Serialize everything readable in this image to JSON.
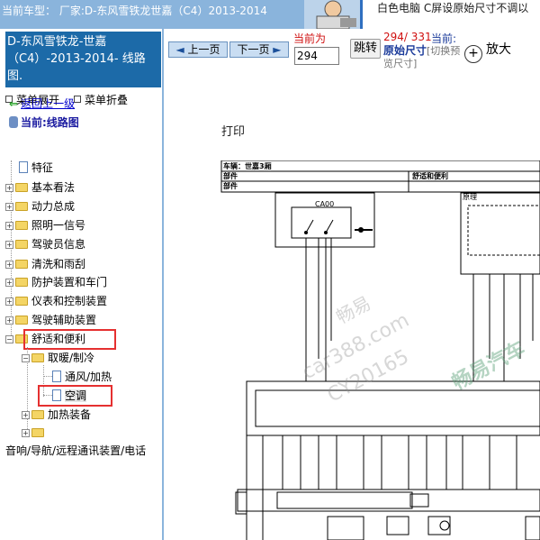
{
  "header": {
    "breadcrumb": "当前车型： 厂家:D-东风雪铁龙世嘉（C4）2013-2014",
    "banner_text": "白色电脑 C屏设原始尺寸不调以"
  },
  "sidebar": {
    "title": "D-东风雪铁龙-世嘉（C4）-2013-2014- 线路图.",
    "expand_label": "菜单展开",
    "collapse_label": "菜单折叠",
    "back_label": "返回上一级",
    "current_label": "当前:线路图",
    "items": [
      {
        "label": "特征"
      },
      {
        "label": "基本看法"
      },
      {
        "label": "动力总成"
      },
      {
        "label": "照明一信号"
      },
      {
        "label": "驾驶员信息"
      },
      {
        "label": "清洗和雨刮"
      },
      {
        "label": "防护装置和车门"
      },
      {
        "label": "仪表和控制装置"
      },
      {
        "label": "驾驶辅助装置"
      },
      {
        "label": "舒适和便利"
      },
      {
        "label": "取暖/制冷"
      },
      {
        "label": "通风/加热"
      },
      {
        "label": "空调"
      },
      {
        "label": "加热装备"
      },
      {
        "label": ""
      },
      {
        "label": "音响/导航/远程通讯装置/电话"
      }
    ]
  },
  "toolbar": {
    "prev_label": "上一页",
    "next_label": "下一页",
    "page_label": "当前为",
    "page_value": "294",
    "jump_label": "跳转",
    "page_count": "294/ 331",
    "current_suffix": "当前:",
    "orig_size": "原始尺寸",
    "switch_text": "[切换预览尺寸]",
    "zoom_label": "放大"
  },
  "document": {
    "print_title": "打印",
    "row1": "车辆：世嘉3厢",
    "row2": "部件",
    "row2b": "舒适和便利",
    "row3": "部件",
    "row3b": "原理",
    "comp_label": "CA00",
    "watermarks": [
      "畅易",
      "car388.com",
      "CY20165",
      "畅易汽车"
    ]
  }
}
